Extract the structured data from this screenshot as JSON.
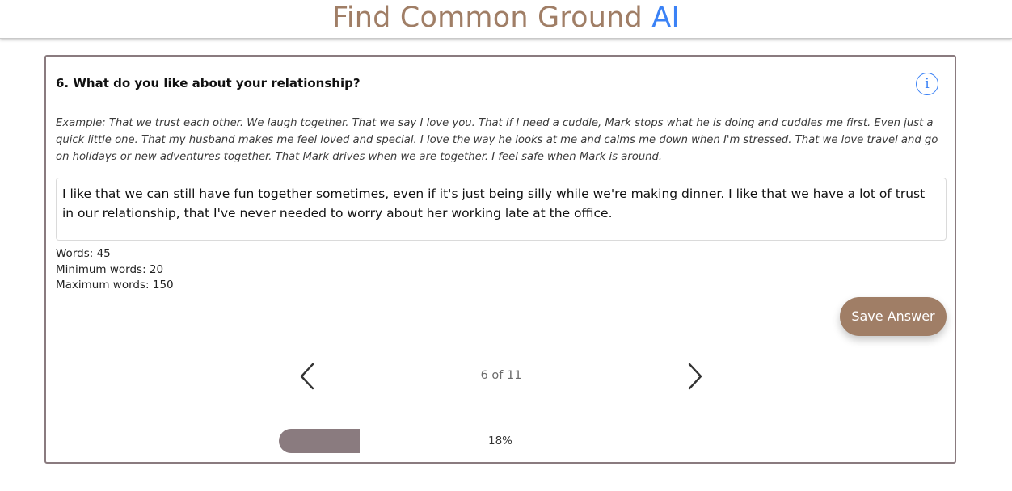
{
  "header": {
    "brand_main": "Find Common Ground",
    "brand_ai": "AI"
  },
  "question": {
    "title": "6. What do you like about your relationship?",
    "info_icon": "info-icon",
    "info_glyph": "i",
    "example": "Example: That we trust each other. We laugh together. That we say I love you. That if I need a cuddle, Mark stops what he is doing and cuddles me first. Even just a quick little one. That my husband makes me feel loved and special. I love the way he looks at me and calms me down when I'm stressed. That we love travel and go on holidays or new adventures together. That Mark drives when we are together. I feel safe when Mark is around.",
    "answer": "I like that we can still have fun together sometimes, even if it's just being silly while we're making dinner. I like that we have a lot of trust in our relationship, that I've never needed to worry about her working late at the office."
  },
  "counts": {
    "words": "Words: 45",
    "minimum": "Minimum words: 20",
    "maximum": "Maximum words: 150"
  },
  "actions": {
    "save_label": "Save Answer"
  },
  "navigation": {
    "prev_icon": "chevron-left-icon",
    "next_icon": "chevron-right-icon",
    "page_indicator": "6 of 11"
  },
  "progress": {
    "value": 0.18,
    "label": "18%"
  },
  "colors": {
    "brand": "#a07e66",
    "ai_accent": "#3b82f6",
    "card_border": "#8a7b7f"
  }
}
